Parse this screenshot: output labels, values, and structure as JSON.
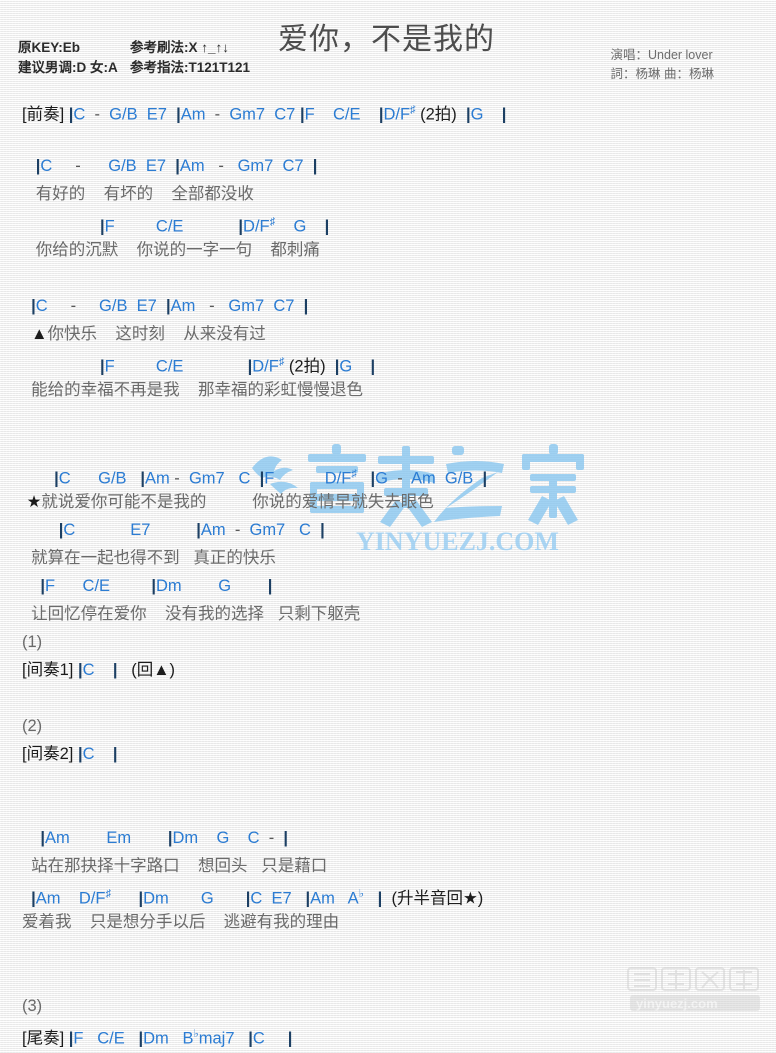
{
  "header": {
    "title": "爱你，不是我的",
    "meta": [
      {
        "label": "原KEY:Eb",
        "value": "参考刷法:X ↑_↑↓"
      },
      {
        "label": "建议男调:D 女:A",
        "value": "参考指法:T121T121"
      }
    ],
    "credits": {
      "singer": "演唱：Under lover",
      "writers": "詞：杨琳  曲：杨琳"
    }
  },
  "colors": {
    "chord": "#2b7cd3",
    "lyric": "#6b6b6b",
    "tag": "#1c1c1c",
    "bar": "#1c3f63",
    "watermark": "#7ec2ef",
    "background": "#f4f4f4"
  },
  "sections": [
    {
      "name": "intro",
      "lines": [
        {
          "type": "chords",
          "text": "[前奏] |C  -  G/B  E7  |Am  -  Gm7  C7 |F    C/E    |D/F# (2拍)  |G    |"
        }
      ]
    },
    {
      "name": "verse-1a",
      "lines": [
        {
          "type": "blank",
          "text": " "
        },
        {
          "type": "chords",
          "text": "   |C     -      G/B  E7  |Am   -   Gm7  C7  |"
        },
        {
          "type": "lyrics",
          "text": "   有好的    有坏的    全部都没收"
        }
      ]
    },
    {
      "name": "verse-1b",
      "lines": [
        {
          "type": "chords",
          "text": "                 |F         C/E            |D/F#    G    |"
        },
        {
          "type": "lyrics",
          "text": "   你给的沉默    你说的一字一句    都刺痛"
        }
      ]
    },
    {
      "name": "verse-2a",
      "lines": [
        {
          "type": "blank",
          "text": " "
        },
        {
          "type": "chords",
          "text": "  |C     -     G/B  E7  |Am   -   Gm7  C7  |"
        },
        {
          "type": "lyrics",
          "text": "  ▲你快乐    这时刻    从来没有过"
        }
      ]
    },
    {
      "name": "verse-2b",
      "lines": [
        {
          "type": "chords",
          "text": "                 |F         C/E              |D/F# (2拍)  |G    |"
        },
        {
          "type": "lyrics",
          "text": "  能给的幸福不再是我    那幸福的彩虹慢慢退色"
        }
      ]
    },
    {
      "name": "chorus-a",
      "lines": [
        {
          "type": "blank",
          "text": " "
        },
        {
          "type": "blank",
          "text": " "
        },
        {
          "type": "chords",
          "text": "       |C      G/B   |Am -  Gm7   C  |F           D/F#   |G  -  Am  G/B  |"
        },
        {
          "type": "lyrics",
          "text": " ★就说爱你可能不是我的          你说的爱情早就失去眼色"
        }
      ]
    },
    {
      "name": "chorus-b",
      "lines": [
        {
          "type": "chords",
          "text": "        |C            E7          |Am  -  Gm7   C  |"
        },
        {
          "type": "lyrics",
          "text": "  就算在一起也得不到   真正的快乐"
        }
      ]
    },
    {
      "name": "chorus-c",
      "lines": [
        {
          "type": "chords",
          "text": "    |F      C/E         |Dm        G        |"
        },
        {
          "type": "lyrics",
          "text": "  让回忆停在爱你    没有我的选择   只剩下躯壳"
        }
      ]
    },
    {
      "name": "interlude-1",
      "lines": [
        {
          "type": "num",
          "text": "(1)"
        },
        {
          "type": "chords",
          "text": "[间奏1] |C    |   (回▲)"
        }
      ]
    },
    {
      "name": "interlude-2",
      "lines": [
        {
          "type": "blank",
          "text": " "
        },
        {
          "type": "num",
          "text": "(2)"
        },
        {
          "type": "chords",
          "text": "[间奏2] |C    |"
        }
      ]
    },
    {
      "name": "bridge-a",
      "lines": [
        {
          "type": "blank",
          "text": " "
        },
        {
          "type": "blank",
          "text": " "
        },
        {
          "type": "chords",
          "text": "    |Am        Em        |Dm    G    C  -  |"
        },
        {
          "type": "lyrics",
          "text": "  站在那抉择十字路口    想回头   只是藉口"
        }
      ]
    },
    {
      "name": "bridge-b",
      "lines": [
        {
          "type": "chords",
          "text": "  |Am    D/F#      |Dm       G       |C  E7   |Am   Ab   |  (升半音回★)"
        },
        {
          "type": "lyrics",
          "text": "爱着我    只是想分手以后    逃避有我的理由"
        }
      ]
    },
    {
      "name": "outro",
      "lines": [
        {
          "type": "blank",
          "text": " "
        },
        {
          "type": "blank",
          "text": " "
        },
        {
          "type": "num",
          "text": "(3)"
        },
        {
          "type": "chords",
          "text": "[尾奏] |F   C/E   |Dm   Bbmaj7   |C     |"
        }
      ]
    }
  ],
  "watermarks": {
    "center": {
      "logo_text": "音乐之家",
      "url_text": "YINYUEZJ.COM"
    },
    "bottom": {
      "logo_text": "音乐之家",
      "url_text": "yinyuezj.com"
    }
  }
}
